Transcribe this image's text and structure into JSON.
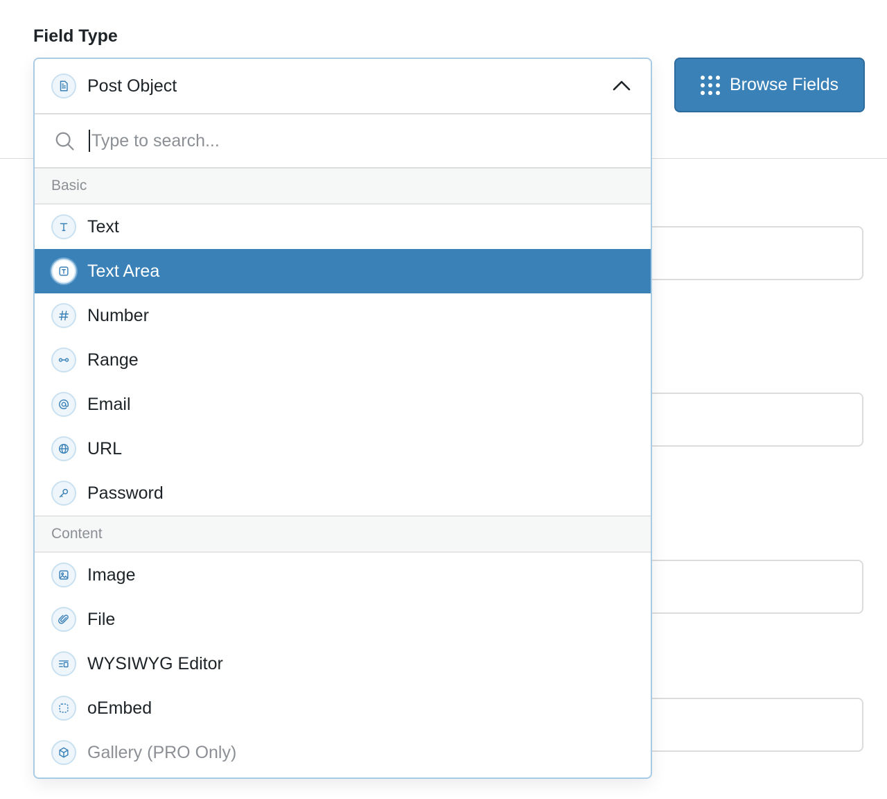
{
  "field_label": "Field Type",
  "browse_button": {
    "label": "Browse Fields",
    "icon": "grid-dots-icon"
  },
  "dropdown": {
    "selected_value": "Post Object",
    "selected_icon": "document-icon",
    "search_placeholder": "Type to search...",
    "groups": [
      {
        "label": "Basic",
        "options": [
          {
            "label": "Text",
            "icon": "text-icon",
            "selected": false
          },
          {
            "label": "Text Area",
            "icon": "textarea-icon",
            "selected": true
          },
          {
            "label": "Number",
            "icon": "hash-icon",
            "selected": false
          },
          {
            "label": "Range",
            "icon": "range-icon",
            "selected": false
          },
          {
            "label": "Email",
            "icon": "at-icon",
            "selected": false
          },
          {
            "label": "URL",
            "icon": "globe-icon",
            "selected": false
          },
          {
            "label": "Password",
            "icon": "key-icon",
            "selected": false
          }
        ]
      },
      {
        "label": "Content",
        "options": [
          {
            "label": "Image",
            "icon": "image-icon",
            "selected": false
          },
          {
            "label": "File",
            "icon": "paperclip-icon",
            "selected": false
          },
          {
            "label": "WYSIWYG Editor",
            "icon": "editor-icon",
            "selected": false
          },
          {
            "label": "oEmbed",
            "icon": "embed-icon",
            "selected": false
          },
          {
            "label": "Gallery (PRO Only)",
            "icon": "gallery-icon",
            "selected": false,
            "disabled": true
          }
        ]
      }
    ]
  },
  "colors": {
    "accent": "#3a81b8",
    "icon_stroke": "#3a81b8",
    "border": "#dcdcde"
  }
}
